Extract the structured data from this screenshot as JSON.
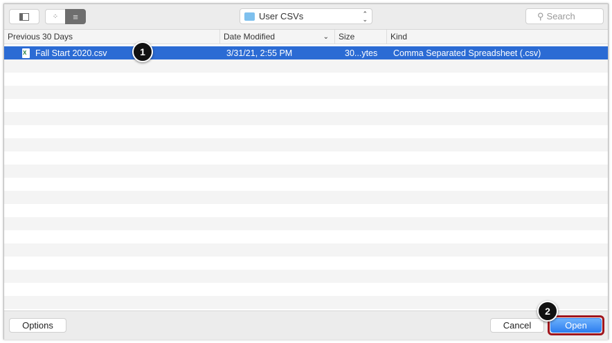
{
  "toolbar": {
    "location": "User CSVs",
    "search_placeholder": "Search"
  },
  "columns": {
    "name": "Previous 30 Days",
    "date": "Date Modified",
    "size": "Size",
    "kind": "Kind"
  },
  "files": [
    {
      "name": "Fall Start 2020.csv",
      "date": "3/31/21, 2:55 PM",
      "size": "30...ytes",
      "kind": "Comma Separated Spreadsheet (.csv)"
    }
  ],
  "buttons": {
    "options": "Options",
    "cancel": "Cancel",
    "open": "Open"
  },
  "callouts": [
    "1",
    "2"
  ],
  "colors": {
    "selection": "#2b6bd4",
    "callout_outline": "#a0151d"
  }
}
